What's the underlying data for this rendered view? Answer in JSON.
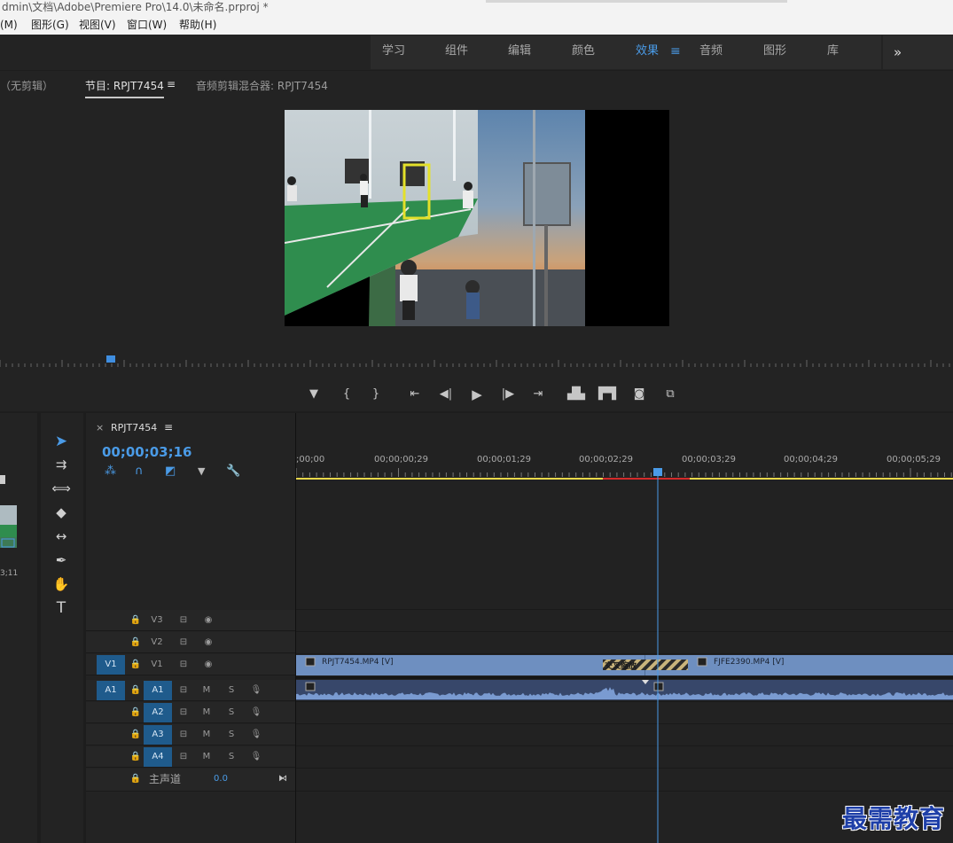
{
  "window": {
    "title": "dmin\\文档\\Adobe\\Premiere Pro\\14.0\\未命名.prproj *"
  },
  "menu": [
    "(M)",
    "图形(G)",
    "视图(V)",
    "窗口(W)",
    "帮助(H)"
  ],
  "workspaces": {
    "items": [
      "学习",
      "组件",
      "编辑",
      "颜色",
      "效果",
      "音频",
      "图形",
      "库"
    ],
    "active": "效果",
    "more_label": "»"
  },
  "monitor": {
    "tab_source": "（无剪辑）",
    "tab_program": "节目: RPJT7454",
    "tab_mixer": "音频剪辑混合器: RPJT7454"
  },
  "timeline": {
    "sequence_name": "RPJT7454",
    "timecode": "00;00;03;16",
    "ruler_labels": [
      ";00;00",
      "00;00;00;29",
      "00;00;01;29",
      "00;00;02;29",
      "00;00;03;29",
      "00;00;04;29",
      "00;00;05;29"
    ],
    "video_tracks": [
      "V3",
      "V2",
      "V1"
    ],
    "source_v": "V1",
    "audio_tracks": [
      "A1",
      "A2",
      "A3",
      "A4"
    ],
    "source_a": "A1",
    "mute_label": "M",
    "solo_label": "S",
    "master_label": "主声道",
    "master_value": "0.0",
    "clips": {
      "v1_clip1": "RPJT7454.MP4 [V]",
      "v1_clip2": "FJFE2390.MP4 [V]",
      "transition": "交叉缩放"
    },
    "playhead_fraction": 0.55
  },
  "left_panel": {
    "partial_time": "3;11"
  },
  "watermark": "最需教育",
  "colors": {
    "accent": "#4a9be7",
    "clip_video": "#6e8fc0",
    "clip_audio": "#37476a",
    "work_area": "#e8d84a",
    "render_red": "#d42a2a"
  }
}
